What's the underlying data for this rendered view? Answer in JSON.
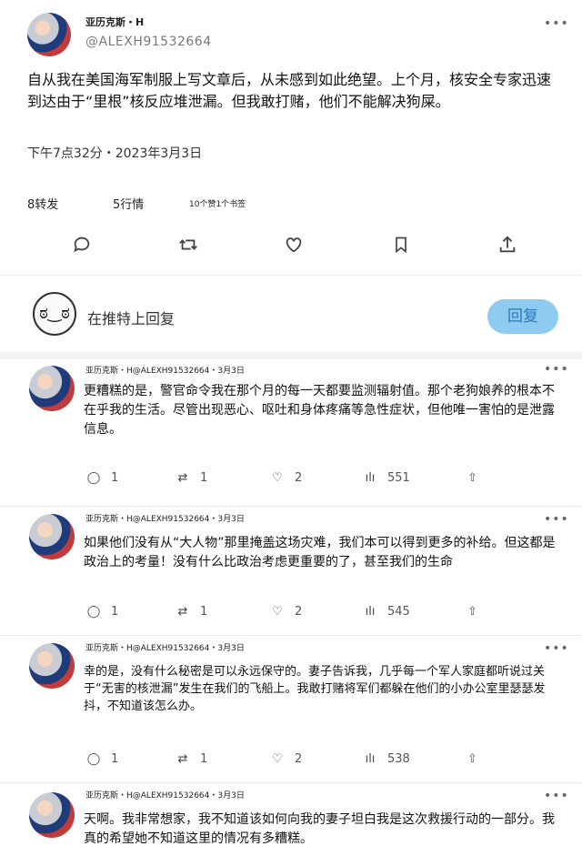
{
  "tweet": {
    "author_name": "亚历克斯・H",
    "handle": "@ALEXH91532664",
    "text": "自从我在美国海军制服上写文章后，从未感到如此绝望。上个月，核安全专家迅速到达由于“里根”核反应堆泄漏。但我敢打赌，他们不能解决狗屎。",
    "timestamp": "下午7点32分・2023年3月3日",
    "retweets": "8转发",
    "quotes": "5行情",
    "likes_bookmarks": "10个赞1个书签",
    "more_icon": "more-dots-icon"
  },
  "reply_box": {
    "hint": "在推特上回复",
    "button": "回复"
  },
  "replies": [
    {
      "meta": "亚历克斯・H@ALEXH91532664・3月3日",
      "text": "更糟糕的是，警官命令我在那个月的每一天都要监测辐射值。那个老狗娘养的根本不在乎我的生活。尽管出现恶心、呕吐和身体疼痛等急性症状，但他唯一害怕的是泄露信息。",
      "replies": "1",
      "retweets": "1",
      "likes": "2",
      "views": "551"
    },
    {
      "meta": "亚历克斯・H@ALEXH91532664・3月3日",
      "text": "如果他们没有从“大人物”那里掩盖这场灾难，我们本可以得到更多的补给。但这都是政治上的考量！没有什么比政治考虑更重要的了，甚至我们的生命",
      "replies": "1",
      "retweets": "1",
      "likes": "2",
      "views": "545"
    },
    {
      "meta": "亚历克斯・H@ALEXH91532664・3月3日",
      "text": "幸的是，没有什么秘密是可以永远保守的。妻子告诉我，几乎每一个军人家庭都听说过关于“无害的核泄漏”发生在我们的飞船上。我敢打赌将军们都躲在他们的小办公室里瑟瑟发抖，不知道该怎么办。",
      "replies": "1",
      "retweets": "1",
      "likes": "2",
      "views": "538"
    },
    {
      "meta": "亚历克斯・H@ALEXH91532664・3月3日",
      "text": "天啊。我非常想家，我不知道该如何向我的妻子坦白我是这次救援行动的一部分。我真的希望她不知道这里的情况有多糟糕。"
    }
  ]
}
